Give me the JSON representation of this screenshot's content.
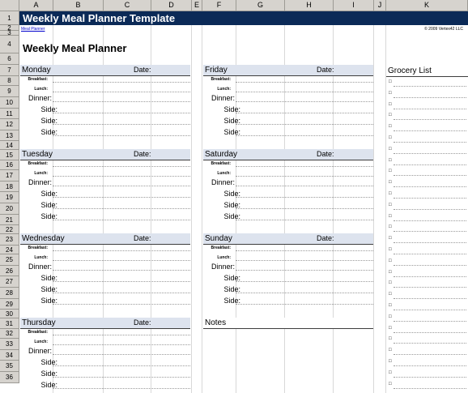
{
  "columns": [
    "A",
    "B",
    "C",
    "D",
    "E",
    "F",
    "G",
    "H",
    "I",
    "J",
    "K"
  ],
  "rows": [
    "1",
    "2",
    "3",
    "4",
    "6",
    "7",
    "8",
    "9",
    "10",
    "11",
    "12",
    "13",
    "14",
    "15",
    "16",
    "17",
    "18",
    "19",
    "20",
    "21",
    "22",
    "23",
    "24",
    "25",
    "26",
    "27",
    "28",
    "29",
    "30",
    "31",
    "32",
    "33",
    "34",
    "35",
    "36"
  ],
  "title": "Weekly Meal Planner Template",
  "source_link": "Meal Planner",
  "copyright": "© 2009 Vertex42 LLC",
  "heading": "Weekly Meal Planner",
  "date_label": "Date:",
  "meal_labels": {
    "breakfast": "Breakfast:",
    "lunch": "Lunch:",
    "dinner": "Dinner:",
    "side": "Side:"
  },
  "days_left": [
    "Monday",
    "Tuesday",
    "Wednesday",
    "Thursday"
  ],
  "days_right": [
    "Friday",
    "Saturday",
    "Sunday"
  ],
  "notes_label": "Notes",
  "grocery_label": "Grocery List",
  "bullet": "□",
  "colors": {
    "title_bg": "#0b2a57",
    "day_bg": "#dde3ee",
    "header_bg": "#d6d3ce"
  }
}
